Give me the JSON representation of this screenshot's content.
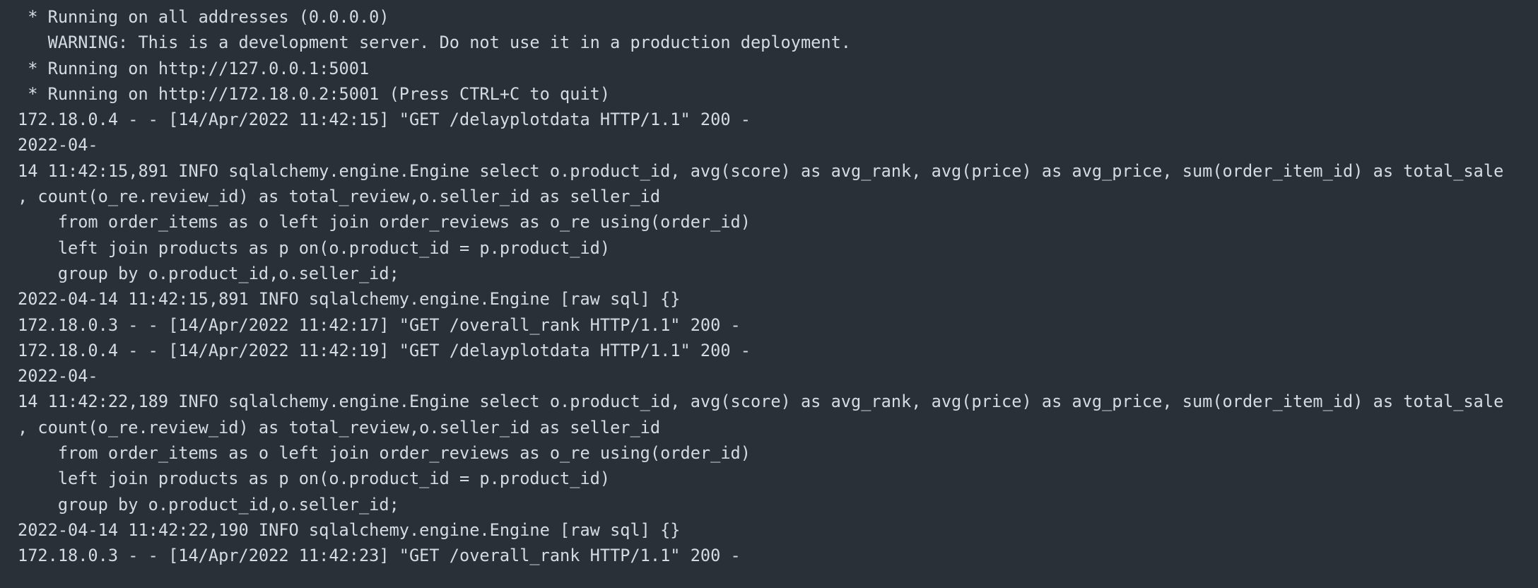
{
  "terminal": {
    "lines": [
      " * Running on all addresses (0.0.0.0)",
      "   WARNING: This is a development server. Do not use it in a production deployment.",
      " * Running on http://127.0.0.1:5001",
      " * Running on http://172.18.0.2:5001 (Press CTRL+C to quit)",
      "172.18.0.4 - - [14/Apr/2022 11:42:15] \"GET /delayplotdata HTTP/1.1\" 200 -",
      "2022-04-",
      "14 11:42:15,891 INFO sqlalchemy.engine.Engine select o.product_id, avg(score) as avg_rank, avg(price) as avg_price, sum(order_item_id) as total_sale",
      ", count(o_re.review_id) as total_review,o.seller_id as seller_id",
      "    from order_items as o left join order_reviews as o_re using(order_id)",
      "    left join products as p on(o.product_id = p.product_id)",
      "    group by o.product_id,o.seller_id;",
      "2022-04-14 11:42:15,891 INFO sqlalchemy.engine.Engine [raw sql] {}",
      "172.18.0.3 - - [14/Apr/2022 11:42:17] \"GET /overall_rank HTTP/1.1\" 200 -",
      "172.18.0.4 - - [14/Apr/2022 11:42:19] \"GET /delayplotdata HTTP/1.1\" 200 -",
      "2022-04-",
      "14 11:42:22,189 INFO sqlalchemy.engine.Engine select o.product_id, avg(score) as avg_rank, avg(price) as avg_price, sum(order_item_id) as total_sale",
      ", count(o_re.review_id) as total_review,o.seller_id as seller_id",
      "    from order_items as o left join order_reviews as o_re using(order_id)",
      "    left join products as p on(o.product_id = p.product_id)",
      "    group by o.product_id,o.seller_id;",
      "2022-04-14 11:42:22,190 INFO sqlalchemy.engine.Engine [raw sql] {}",
      "172.18.0.3 - - [14/Apr/2022 11:42:23] \"GET /overall_rank HTTP/1.1\" 200 -"
    ]
  },
  "colors": {
    "background": "#2a3038",
    "text": "#d6dbe2"
  }
}
